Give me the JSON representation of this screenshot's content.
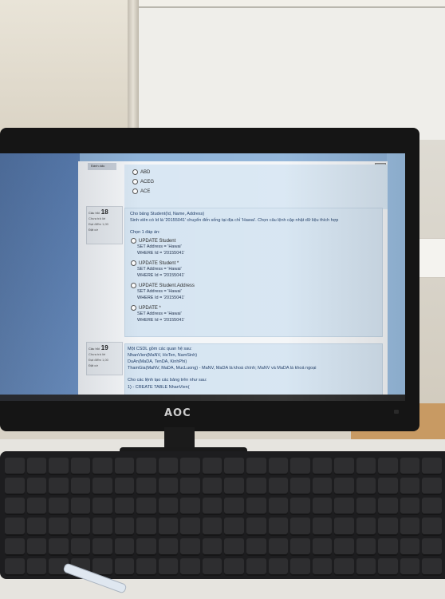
{
  "monitor": {
    "brand": "AOC"
  },
  "page": {
    "top_button": "Đánh dấu",
    "prev_options": [
      "ABD",
      "ACEG",
      "ACE"
    ],
    "q18": {
      "label": "Câu hỏi",
      "number": "18",
      "status": "Chưa trả lời",
      "score": "Đạt điểm 1,00",
      "flag": "Đặt cờ",
      "text_line1": "Cho bảng Student(Id, Name, Address)",
      "text_line2": "Sinh viên có Id là '20155041' chuyển đến sống tại địa chỉ 'Hawai'. Chọn câu lệnh cập nhật dữ liệu thích hợp",
      "choose": "Chọn 1 đáp án:",
      "options": [
        {
          "l1": "UPDATE Student",
          "l2": "SET Address = 'Hawai'",
          "l3": "WHERE Id = '20155041'"
        },
        {
          "l1": "UPDATE Student *",
          "l2": "SET Address = 'Hawai'",
          "l3": "WHERE Id = '20155041'"
        },
        {
          "l1": "UPDATE Student.Address",
          "l2": "SET Address = 'Hawai'",
          "l3": "WHERE Id = '20155041'"
        },
        {
          "l1": "UPDATE *",
          "l2": "SET Address = 'Hawai'",
          "l3": "WHERE Id = '20155041'"
        }
      ]
    },
    "q19": {
      "label": "Câu hỏi",
      "number": "19",
      "status": "Chưa trả lời",
      "score": "Đạt điểm 1,00",
      "flag": "Đặt cờ",
      "lines": [
        "Một CSDL gồm các quan hệ sau:",
        "NhanVien(MaNV, HoTen, NamSinh)",
        "DuAn(MaDA, TenDA, KinhPhi)",
        "ThamGia(MaNV, MaDA, MucLuong) - MaNV, MaDA là khoá chính; MaNV và MaDA là khoá ngoại",
        "Cho các lệnh tạo các bảng trên như sau:",
        "1) - CREATE TABLE NhanVien("
      ]
    }
  }
}
